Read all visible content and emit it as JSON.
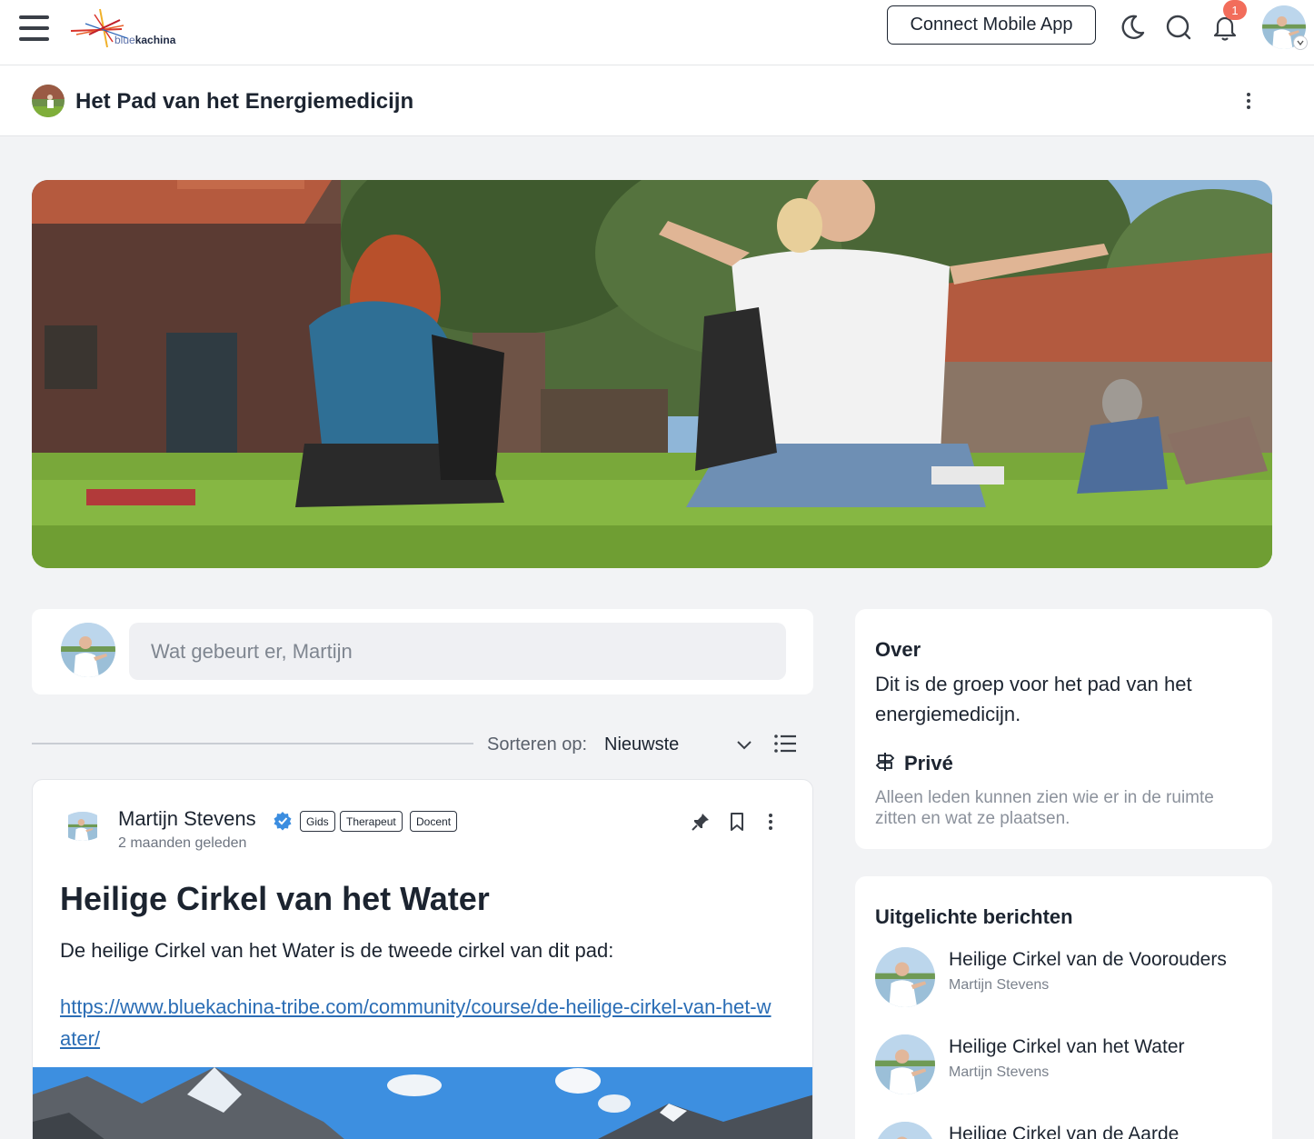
{
  "topbar": {
    "logo_prefix": "blue",
    "logo_suffix": "kachina",
    "connect_label": "Connect Mobile App",
    "notification_count": "1",
    "icons": [
      "menu-icon",
      "moon-icon",
      "search-icon",
      "bell-icon"
    ]
  },
  "group": {
    "title": "Het Pad van het Energiemedicijn"
  },
  "composer": {
    "placeholder": "Wat gebeurt er, Martijn"
  },
  "sort": {
    "label": "Sorteren op:",
    "value": "Nieuwste"
  },
  "post": {
    "author": "Martijn Stevens",
    "tags": [
      "Gids",
      "Therapeut",
      "Docent"
    ],
    "time": "2 maanden geleden",
    "title": "Heilige Cirkel van het Water",
    "body": "De heilige Cirkel van het Water is de tweede cirkel van dit pad:",
    "link": "https://www.bluekachina-tribe.com/community/course/de-heilige-cirkel-van-het-water/"
  },
  "about": {
    "title": "Over",
    "text": "Dit is de groep voor het pad van het energiemedicijn.",
    "privacy_title": "Privé",
    "privacy_text": "Alleen leden kunnen zien wie er in de ruimte zitten en wat ze plaatsen."
  },
  "featured": {
    "title": "Uitgelichte berichten",
    "items": [
      {
        "title": "Heilige Cirkel van de Voorouders",
        "author": "Martijn Stevens"
      },
      {
        "title": "Heilige Cirkel van het Water",
        "author": "Martijn Stevens"
      },
      {
        "title": "Heilige Cirkel van de Aarde",
        "author": ""
      }
    ]
  },
  "colors": {
    "accent_link": "#2a6db5",
    "badge": "#f26d5b",
    "verified": "#3b8de0"
  }
}
